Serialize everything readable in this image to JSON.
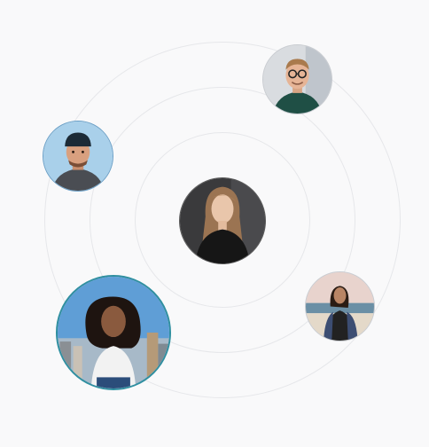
{
  "avatars": [
    {
      "icon": "avatar-woman-portrait-dark-icon",
      "position": "center"
    },
    {
      "icon": "avatar-man-glasses-icon",
      "position": "top-right"
    },
    {
      "icon": "avatar-man-cap-icon",
      "position": "left"
    },
    {
      "icon": "avatar-woman-city-icon",
      "position": "bottom-left"
    },
    {
      "icon": "avatar-woman-beach-icon",
      "position": "bottom-right"
    }
  ],
  "colors": {
    "background": "#f9f9fa",
    "ring": "#e6e7ea",
    "accent_border": "#2f8fa0"
  }
}
